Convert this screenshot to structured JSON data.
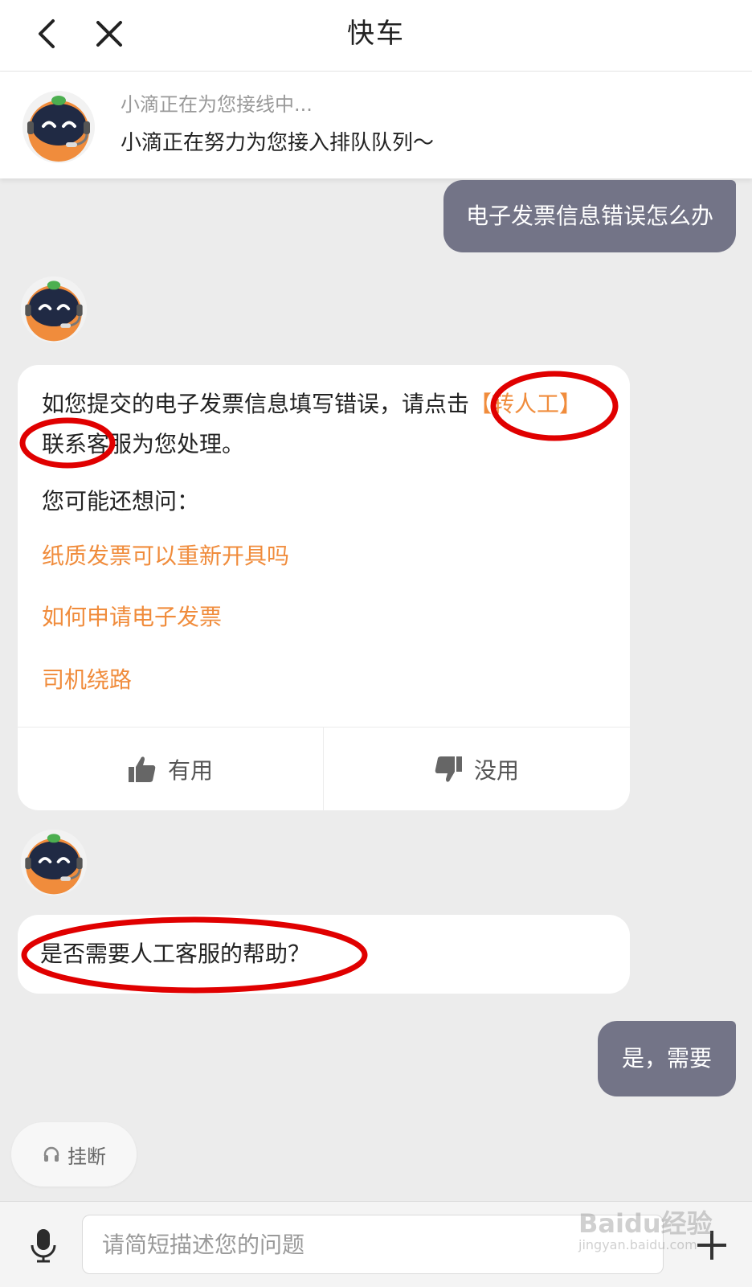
{
  "header": {
    "title": "快车"
  },
  "status": {
    "line1": "小滴正在为您接线中...",
    "line2": "小滴正在努力为您接入排队队列～"
  },
  "messages": {
    "user1": "电子发票信息错误怎么办",
    "bot1": {
      "text_before": "如您提交的电子发票信息填写错误，请点击",
      "link": "【转人工】",
      "text_after": "联系客服为您处理。",
      "maybe_label": "您可能还想问：",
      "questions": [
        "纸质发票可以重新开具吗",
        "如何申请电子发票",
        "司机绕路"
      ],
      "useful_label": "有用",
      "useless_label": "没用"
    },
    "bot2": "是否需要人工客服的帮助？",
    "user2": "是，需要"
  },
  "actions": {
    "hangup_label": "挂断"
  },
  "input": {
    "placeholder": "请简短描述您的问题"
  },
  "watermark": {
    "text": "Baidu经验",
    "sub": "jingyan.baidu.com"
  },
  "colors": {
    "accent": "#f08c3c",
    "user_bubble": "#737487",
    "annotation": "#e00000"
  }
}
